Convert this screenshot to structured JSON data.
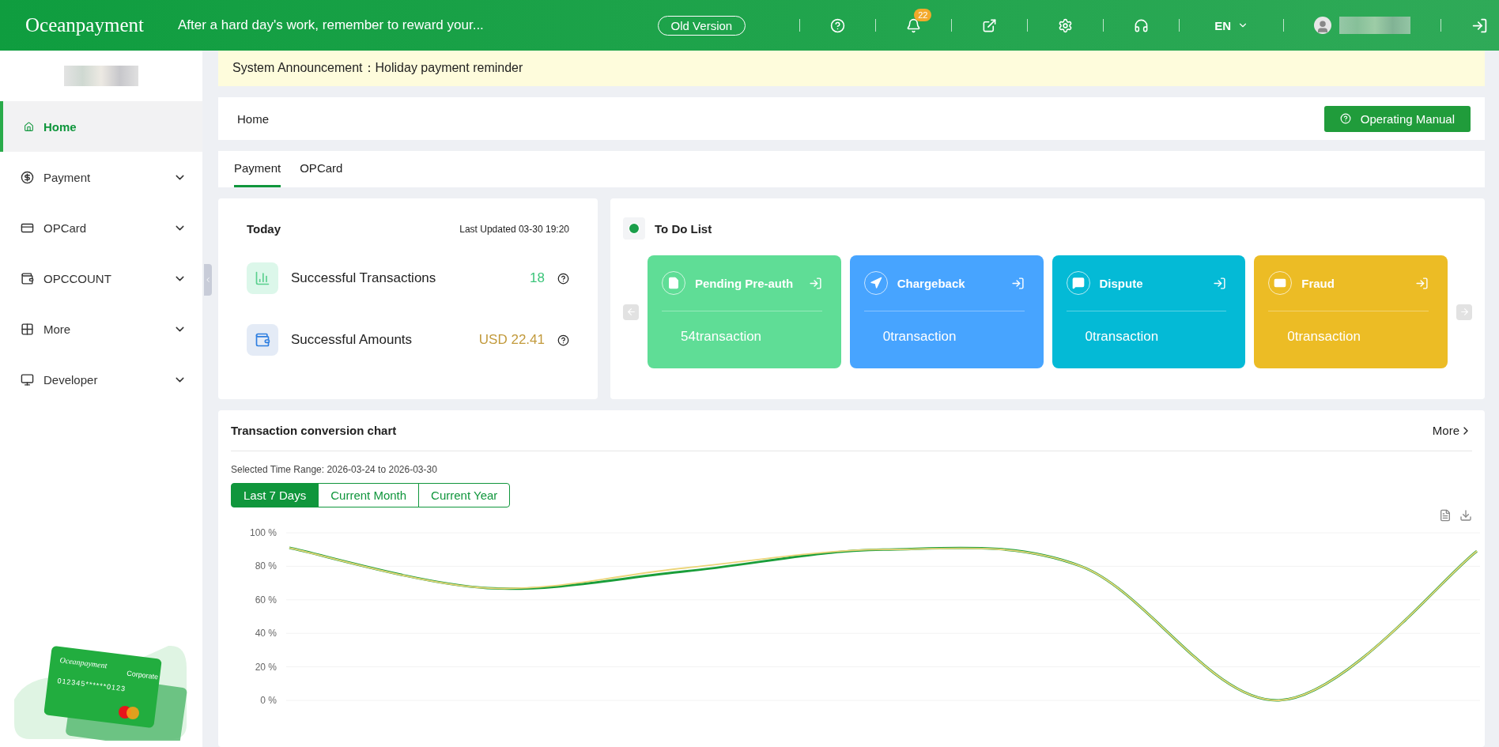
{
  "header": {
    "logo": "Oceanpayment",
    "slogan": "After a hard day's work, remember to reward your...",
    "old_version": "Old Version",
    "notifications": "22",
    "language": "EN"
  },
  "sidebar": {
    "items": [
      {
        "label": "Home",
        "selected": true,
        "expandable": false
      },
      {
        "label": "Payment",
        "selected": false,
        "expandable": true
      },
      {
        "label": "OPCard",
        "selected": false,
        "expandable": true
      },
      {
        "label": "OPCCOUNT",
        "selected": false,
        "expandable": true
      },
      {
        "label": "More",
        "selected": false,
        "expandable": true
      },
      {
        "label": "Developer",
        "selected": false,
        "expandable": true
      }
    ],
    "promo_card": {
      "brand": "Oceanpayment",
      "type": "Corporate",
      "number": "012345******0123"
    }
  },
  "announcement": "System Announcement：Holiday payment reminder",
  "breadcrumb": "Home",
  "manual_button": "Operating Manual",
  "tabs": [
    {
      "label": "Payment",
      "selected": true
    },
    {
      "label": "OPCard",
      "selected": false
    }
  ],
  "today": {
    "title": "Today",
    "updated": "Last Updated 03-30 19:20",
    "stats": [
      {
        "kind": "count",
        "label": "Successful Transactions",
        "value": "18"
      },
      {
        "kind": "amount",
        "label": "Successful Amounts",
        "value": "USD 22.41"
      }
    ]
  },
  "todo": {
    "title": "To Do List",
    "cards": [
      {
        "title": "Pending Pre-auth",
        "count": "54transaction",
        "color": "#5fdd96"
      },
      {
        "title": "Chargeback",
        "count": "0transaction",
        "color": "#47a4ff"
      },
      {
        "title": "Dispute",
        "count": "0transaction",
        "color": "#04bad6"
      },
      {
        "title": "Fraud",
        "count": "0transaction",
        "color": "#ecbc25"
      }
    ]
  },
  "conversion": {
    "title": "Transaction conversion chart",
    "more": "More",
    "range": "Selected Time Range: 2026-03-24 to 2026-03-30",
    "periods": [
      {
        "label": "Last 7 Days",
        "selected": true
      },
      {
        "label": "Current Month",
        "selected": false
      },
      {
        "label": "Current Year",
        "selected": false
      }
    ],
    "chart_data": {
      "type": "line",
      "grid": true,
      "ylim": [
        0,
        100
      ],
      "yticks": [
        {
          "value": 0,
          "label": "0 %"
        },
        {
          "value": 20,
          "label": "20 %"
        },
        {
          "value": 40,
          "label": "40 %"
        },
        {
          "value": 60,
          "label": "60 %"
        },
        {
          "value": 80,
          "label": "80 %"
        },
        {
          "value": 100,
          "label": "100 %"
        }
      ],
      "series": [
        {
          "color": "#1a9e3a",
          "values": [
            91,
            67,
            77,
            90,
            80,
            0,
            89
          ]
        },
        {
          "color": "#ebd57a",
          "values": [
            91,
            67,
            79,
            90,
            80,
            0,
            89
          ]
        }
      ]
    }
  }
}
